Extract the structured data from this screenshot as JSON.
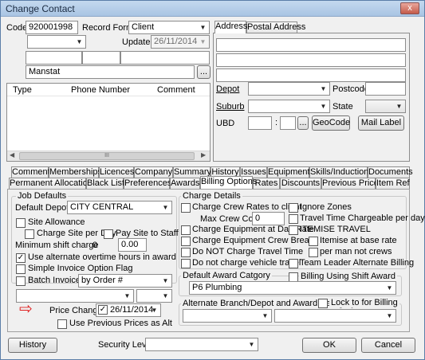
{
  "window": {
    "title": "Change Contact",
    "close_glyph": "x"
  },
  "contact": {
    "code_label": "Code",
    "code_value": "920001998",
    "record_format_label": "Record Format",
    "record_format_value": "Client",
    "updated_label": "Updated",
    "updated_value": "26/11/2014",
    "name_value": "Manstat",
    "ellipsis": "..."
  },
  "phone_list": {
    "columns": [
      "Type",
      "Phone Number",
      "Comment"
    ],
    "scroll_left": "◀",
    "scroll_right": "▶",
    "scroll_grip": "III"
  },
  "address_tabs": [
    "Address",
    "Postal Address"
  ],
  "address": {
    "depot_label": "Depot",
    "postcode_label": "Postcode",
    "suburb_label": "Suburb",
    "state_label": "State",
    "ubd_label": "UBD",
    "ubd_sep": ":",
    "ellipsis": "...",
    "geocode_button": "GeoCode",
    "mail_label_button": "Mail Label"
  },
  "tabs_row1": [
    "Comments",
    "Memberships",
    "Licences",
    "Company",
    "Summary",
    "History",
    "Issues",
    "Equipment",
    "Skills/Inductions",
    "Documents"
  ],
  "tabs_row2": [
    "Permanent Allocations",
    "Black List",
    "Preferences",
    "Awards",
    "Billing Options",
    "Rates",
    "Discounts",
    "Previous Prices",
    "Item Ref"
  ],
  "job_defaults": {
    "group_title": "Job Defaults",
    "default_depot_label": "Default Depot",
    "default_depot_value": "CITY CENTRAL",
    "site_allowance": "Site Allowance",
    "charge_site_per_day": "Charge Site per Day",
    "pay_site_to_staff": "Pay Site to Staff",
    "minimum_shift_label": "Minimum shift charge",
    "minimum_shift_value_a": "0",
    "minimum_shift_value_b": "0.00",
    "alt_overtime": "Use alternate overtime hours in award",
    "alt_overtime_check": "✓",
    "simple_invoice": "Simple Invoice Option Flag",
    "batch_invoices": "Batch Invoices",
    "batch_value": "by Order #",
    "price_change_label": "Price Change",
    "price_change_check": "✓",
    "price_change_value": "26/11/2014",
    "use_previous_prices": "Use Previous Prices as Alt",
    "arrow_glyph": "⇨"
  },
  "charge_details": {
    "group_title": "Charge Details",
    "crew_rates": "Charge Crew Rates to client",
    "ignore_zones": "Ignore Zones",
    "max_crew_label": "Max Crew Count",
    "max_crew_value": "0",
    "travel_time_chargeable": "Travel Time Chargeable per day",
    "equip_day_rate": "Charge Equipment at Day Rate",
    "itemise_travel": "ITEMISE TRAVEL",
    "equip_crew_breaks": "Charge Equipment Crew Breaks",
    "itemise_base": "Itemise at base rate",
    "no_travel_time": "Do NOT Charge Travel Time",
    "per_man": "per man not crews",
    "no_vehicle": "Do not charge vehicle travel",
    "team_leader": "Team Leader Alternate Billing"
  },
  "award": {
    "group_title": "Default Award Catgory",
    "value": "P6 Plumbing",
    "billing_shift": "Billing Using Shift Award"
  },
  "alt_branch": {
    "group_title": "Alternate Branch/Depot and Award Category",
    "lock_billing": "Lock to for Billing"
  },
  "footer": {
    "history_button": "History",
    "security_label": "Security Level",
    "ok_button": "OK",
    "cancel_button": "Cancel"
  },
  "colors": {
    "accent_arrow": "#e02020",
    "titlebar": "#b7cfe9"
  }
}
